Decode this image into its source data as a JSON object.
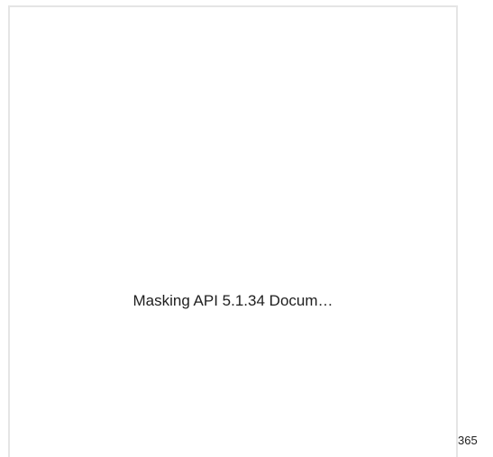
{
  "document_card": {
    "title": "Masking API 5.1.34 Docum…"
  },
  "page_number": "365"
}
